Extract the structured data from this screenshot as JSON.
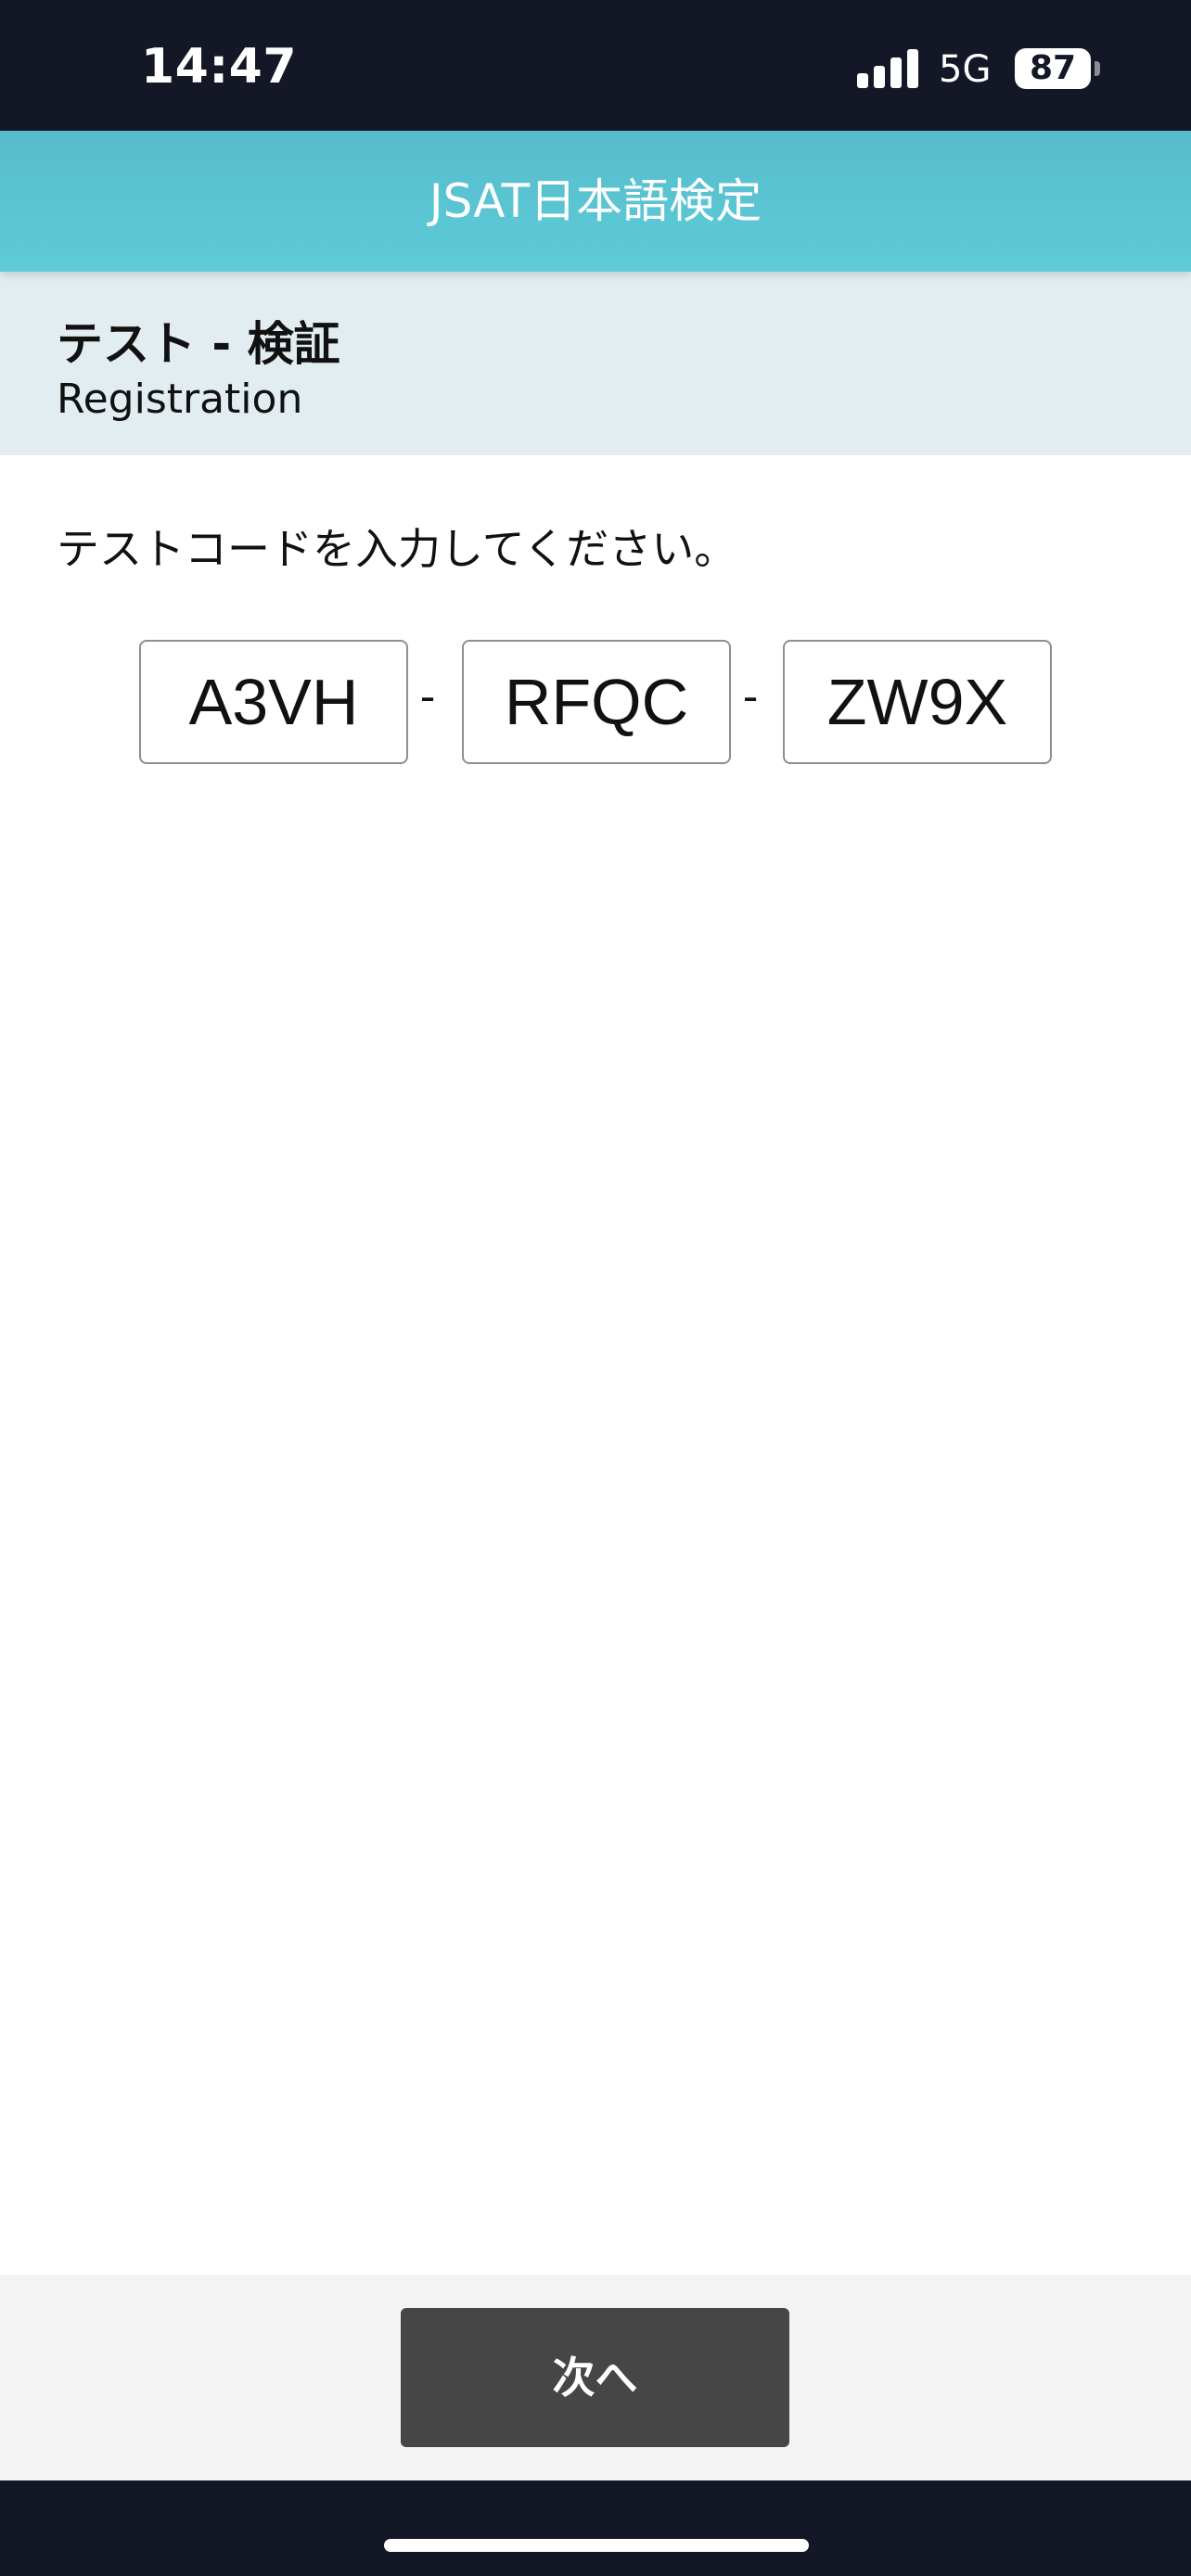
{
  "status_bar": {
    "time": "14:47",
    "network": "5G",
    "battery": "87",
    "signal_icon": "cellular-signal-icon",
    "battery_icon": "battery-icon"
  },
  "header": {
    "title": "JSAT日本語検定"
  },
  "section": {
    "title": "テスト - 検証",
    "subtitle": "Registration"
  },
  "main": {
    "instruction": "テストコードを入力してください。",
    "code_fields": [
      {
        "value": "A3VH"
      },
      {
        "value": "RFQC"
      },
      {
        "value": "ZW9X"
      }
    ],
    "separator": "-"
  },
  "footer": {
    "next_label": "次へ"
  },
  "colors": {
    "status_bar_bg": "#141726",
    "header_bg": "#5ecbd8",
    "section_bg": "#e1edf1",
    "button_bg": "#464646",
    "footer_bg": "#f3f3f3"
  }
}
